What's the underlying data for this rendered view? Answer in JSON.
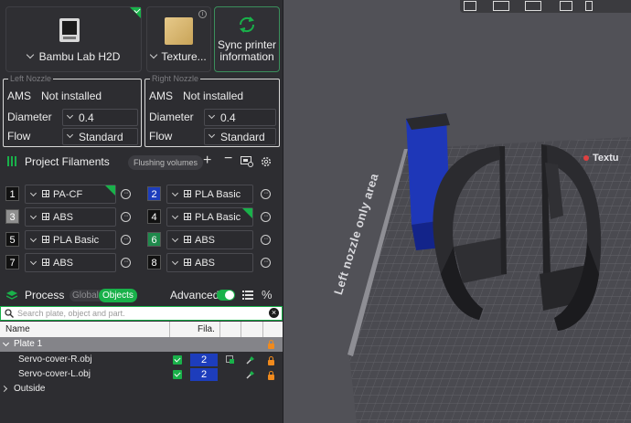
{
  "printer": {
    "name": "Bambu Lab H2D",
    "plate_type": "Texture...",
    "sync_label_line1": "Sync printer",
    "sync_label_line2": "information"
  },
  "nozzles": [
    {
      "title": "Left Nozzle",
      "ams_label": "AMS",
      "ams_value": "Not installed",
      "diameter_label": "Diameter",
      "diameter_value": "0.4",
      "flow_label": "Flow",
      "flow_value": "Standard"
    },
    {
      "title": "Right Nozzle",
      "ams_label": "AMS",
      "ams_value": "Not installed",
      "diameter_label": "Diameter",
      "diameter_value": "0.4",
      "flow_label": "Flow",
      "flow_value": "Standard"
    }
  ],
  "filaments": {
    "title": "Project Filaments",
    "flushing_label": "Flushing volumes",
    "slots": [
      {
        "num": "1",
        "name": "PA-CF",
        "color": "#111111"
      },
      {
        "num": "2",
        "name": "PLA Basic",
        "color": "#1d3dbc"
      },
      {
        "num": "3",
        "name": "ABS",
        "color": "#8f8f8f"
      },
      {
        "num": "4",
        "name": "PLA Basic",
        "color": "#111111"
      },
      {
        "num": "5",
        "name": "PLA Basic",
        "color": "#111111"
      },
      {
        "num": "6",
        "name": "ABS",
        "color": "#1f8a4c"
      },
      {
        "num": "7",
        "name": "ABS",
        "color": "#111111"
      },
      {
        "num": "8",
        "name": "ABS",
        "color": "#111111"
      }
    ]
  },
  "process": {
    "title": "Process",
    "tab_global": "Global",
    "tab_objects": "Objects",
    "advanced_label": "Advanced",
    "search_placeholder": "Search plate, object and part."
  },
  "object_list": {
    "col_name": "Name",
    "col_fila": "Fila.",
    "plate": "Plate 1",
    "objects": [
      {
        "name": "Servo-cover-R.obj",
        "fila": "2"
      },
      {
        "name": "Servo-cover-L.obj",
        "fila": "2"
      }
    ],
    "outside": "Outside"
  },
  "viewport": {
    "area_label": "Left nozzle only area",
    "plate_label": "Textu"
  },
  "colors": {
    "accent": "#19b14a",
    "lock": "#f08a1d",
    "filament_blue": "#1d3dbc"
  }
}
